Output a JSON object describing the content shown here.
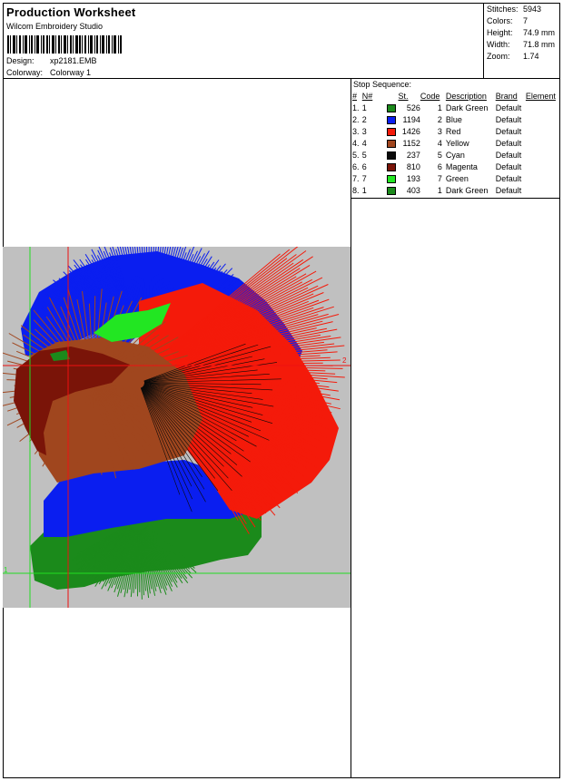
{
  "header": {
    "title": "Production Worksheet",
    "software": "Wilcom Embroidery Studio",
    "design_label": "Design:",
    "design_value": "xp2181.EMB",
    "colorway_label": "Colorway:",
    "colorway_value": "Colorway 1"
  },
  "stats": {
    "stitches_label": "Stitches:",
    "stitches_value": "5943",
    "colors_label": "Colors:",
    "colors_value": "7",
    "height_label": "Height:",
    "height_value": "74.9 mm",
    "width_label": "Width:",
    "width_value": "71.8 mm",
    "zoom_label": "Zoom:",
    "zoom_value": "1.74"
  },
  "stop_sequence": {
    "title": "Stop Sequence:",
    "columns": [
      "#",
      "N#",
      "St.",
      "Code",
      "Description",
      "Brand",
      "Element"
    ],
    "rows": [
      {
        "num": "1.",
        "n": "1",
        "color": "#1b8a1b",
        "st": "526",
        "code": "1",
        "desc": "Dark Green",
        "brand": "Default",
        "element": ""
      },
      {
        "num": "2.",
        "n": "2",
        "color": "#0a1ef0",
        "st": "1194",
        "code": "2",
        "desc": "Blue",
        "brand": "Default",
        "element": ""
      },
      {
        "num": "3.",
        "n": "3",
        "color": "#f41a0a",
        "st": "1426",
        "code": "3",
        "desc": "Red",
        "brand": "Default",
        "element": ""
      },
      {
        "num": "4.",
        "n": "4",
        "color": "#a0461e",
        "st": "1152",
        "code": "4",
        "desc": "Yellow",
        "brand": "Default",
        "element": ""
      },
      {
        "num": "5.",
        "n": "5",
        "color": "#0a0a0a",
        "st": "237",
        "code": "5",
        "desc": "Cyan",
        "brand": "Default",
        "element": ""
      },
      {
        "num": "6.",
        "n": "6",
        "color": "#7a1408",
        "st": "810",
        "code": "6",
        "desc": "Magenta",
        "brand": "Default",
        "element": ""
      },
      {
        "num": "7.",
        "n": "7",
        "color": "#22e622",
        "st": "193",
        "code": "7",
        "desc": "Green",
        "brand": "Default",
        "element": ""
      },
      {
        "num": "8.",
        "n": "1",
        "color": "#1b8a1b",
        "st": "403",
        "code": "1",
        "desc": "Dark Green",
        "brand": "Default",
        "element": ""
      }
    ]
  },
  "design_preview": {
    "background": "#c0c0c0",
    "guide_color": "#22dd22",
    "axis_color": "#ee1111",
    "marker_1": "1",
    "marker_2": "2"
  }
}
